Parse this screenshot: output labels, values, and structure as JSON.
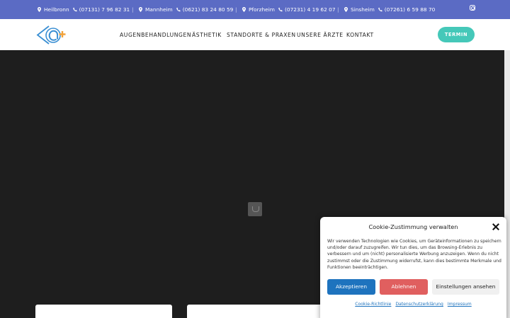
{
  "topbar": {
    "locations": [
      {
        "city": "Heilbronn",
        "phone": "(07131) 7 96 82 31"
      },
      {
        "city": "Mannheim",
        "phone": "(0621) 83 24 80 59"
      },
      {
        "city": "Pforzheim",
        "phone": "(07231) 4 19 62 07"
      },
      {
        "city": "Sinsheim",
        "phone": "(07261) 6 59 88 70"
      }
    ],
    "separator": "|",
    "instagram_icon": "instagram-icon"
  },
  "header": {
    "nav": [
      {
        "label": "AUGENBEHANDLUNGEN"
      },
      {
        "label": "ÄSTHETIK"
      },
      {
        "label": "STANDORTE & PRAXEN"
      },
      {
        "label": "UNSERE ÄRZTE"
      },
      {
        "label": "KONTAKT"
      }
    ],
    "cta_label": "TERMIN"
  },
  "cookie": {
    "title": "Cookie-Zustimmung verwalten",
    "text": "Wir verwenden Technologien wie Cookies, um Geräteinformationen zu speichern und/oder darauf zuzugreifen. Wir tun dies, um das Browsing-Erlebnis zu verbessern und um (nicht) personalisierte Werbung anzuzeigen. Wenn du nicht zustimmst oder die Zustimmung widerrufst, kann dies bestimmte Merkmale und Funktionen beeinträchtigen.",
    "accept_label": "Akzeptieren",
    "deny_label": "Ablehnen",
    "settings_label": "Einstellungen ansehen",
    "links": [
      {
        "label": "Cookie-Richtlinie"
      },
      {
        "label": "Datenschutzerklärung"
      },
      {
        "label": "Impressum"
      }
    ]
  },
  "colors": {
    "topbar": "#5b6bc4",
    "accent": "#45c8b9",
    "accept": "#1e73be",
    "deny": "#e05f5f",
    "hero": "#1e1e1e"
  }
}
